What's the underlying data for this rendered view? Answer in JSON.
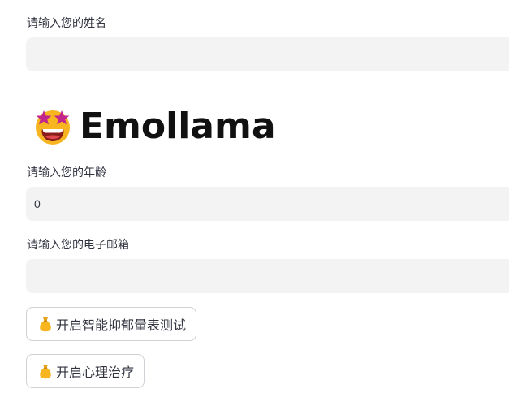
{
  "name_field": {
    "label": "请输入您的姓名",
    "value": ""
  },
  "app_title": {
    "text": "Emollama",
    "icon": "star-struck-emoji"
  },
  "age_field": {
    "label": "请输入您的年龄",
    "value": "0"
  },
  "email_field": {
    "label": "请输入您的电子邮箱",
    "value": ""
  },
  "buttons": [
    {
      "label": "开启智能抑郁量表测试",
      "icon": "money-bag-icon"
    },
    {
      "label": "开启心理治疗",
      "icon": "money-bag-icon"
    }
  ],
  "colors": {
    "input_background": "#f3f3f3",
    "text": "#31333f",
    "button_border": "#d0d0d6",
    "emoji_face": "#f7b520",
    "emoji_star": "#c2258b"
  }
}
